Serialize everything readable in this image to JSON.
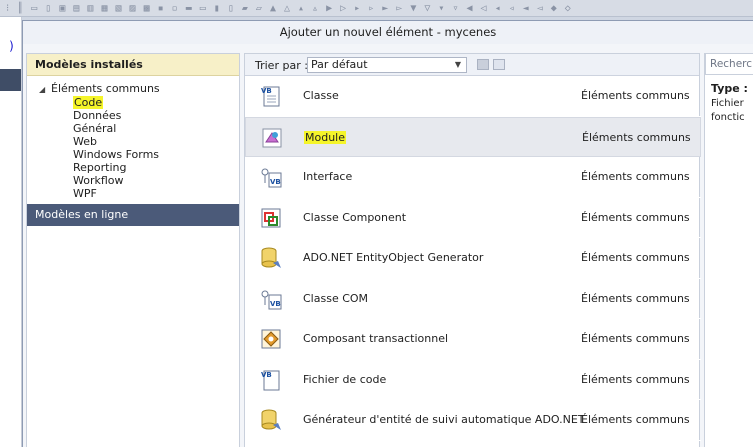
{
  "dialog": {
    "title": "Ajouter un nouvel élément - mycenes"
  },
  "left_pane": {
    "installed_header": "Modèles installés",
    "root_item": "Éléments communs",
    "children": [
      "Code",
      "Données",
      "Général",
      "Web",
      "Windows Forms",
      "Reporting",
      "Workflow",
      "WPF"
    ],
    "highlighted_child": "Code",
    "online_header": "Modèles en ligne"
  },
  "sort": {
    "label": "Trier par :",
    "selected": "Par défaut"
  },
  "templates": [
    {
      "name": "Classe",
      "category": "Éléments communs",
      "icon": "class-icon"
    },
    {
      "name": "Module",
      "category": "Éléments communs",
      "icon": "module-icon"
    },
    {
      "name": "Interface",
      "category": "Éléments communs",
      "icon": "interface-icon"
    },
    {
      "name": "Classe Component",
      "category": "Éléments communs",
      "icon": "component-icon"
    },
    {
      "name": "ADO.NET EntityObject Generator",
      "category": "Éléments communs",
      "icon": "database-generator-icon"
    },
    {
      "name": "Classe COM",
      "category": "Éléments communs",
      "icon": "com-class-icon"
    },
    {
      "name": "Composant transactionnel",
      "category": "Éléments communs",
      "icon": "transaction-component-icon"
    },
    {
      "name": "Fichier de code",
      "category": "Éléments communs",
      "icon": "code-file-icon"
    },
    {
      "name": "Générateur d'entité de suivi automatique ADO.NET",
      "category": "Éléments communs",
      "icon": "database-generator-icon"
    }
  ],
  "selected_template": "Module",
  "right_pane": {
    "search_placeholder": "Recherc",
    "type_label": "Type :",
    "desc_line1": "Fichier",
    "desc_line2": "fonctic"
  },
  "colors": {
    "highlight": "#f5f52a",
    "online_header_bg": "#4b5a79",
    "installed_header_bg": "#f7f0c8"
  }
}
